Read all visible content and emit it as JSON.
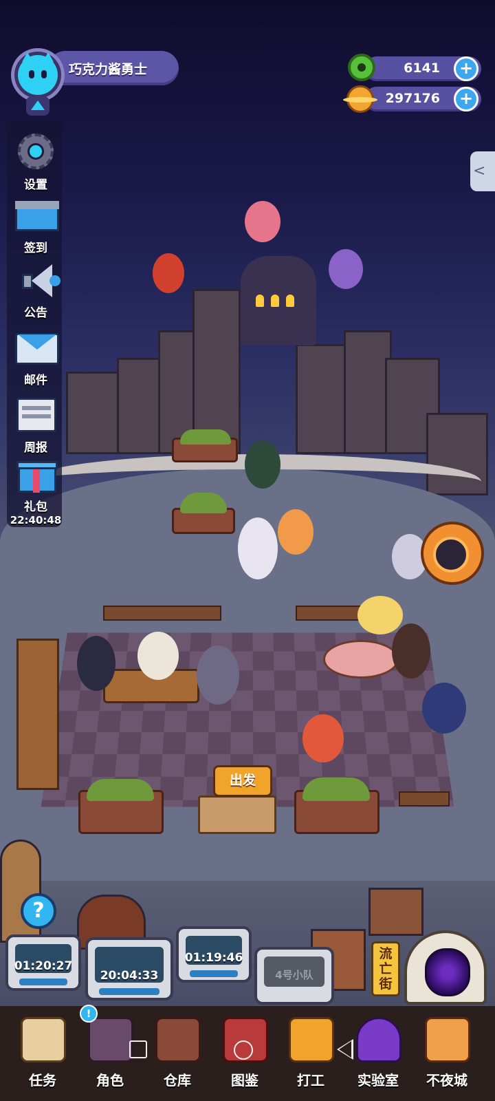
{
  "player": {
    "name": "巧克力酱勇士"
  },
  "currency": [
    {
      "name": "donut",
      "value": "6141",
      "icon": "green-donut-icon",
      "color": "#56c03a"
    },
    {
      "name": "planet-coin",
      "value": "297176",
      "icon": "orange-planet-coin-icon",
      "color": "#f3a530"
    }
  ],
  "sidebar": {
    "items": [
      {
        "label": "设置",
        "icon": "gear-icon"
      },
      {
        "label": "签到",
        "icon": "calendar-checkin-icon"
      },
      {
        "label": "公告",
        "icon": "megaphone-icon"
      },
      {
        "label": "邮件",
        "icon": "mail-envelope-icon"
      },
      {
        "label": "周报",
        "icon": "weekly-report-icon"
      },
      {
        "label": "礼包",
        "icon": "gift-box-icon",
        "timer": "22:40:48"
      }
    ]
  },
  "scene": {
    "depart_label": "出发"
  },
  "squads": [
    {
      "timer": "01:20:27"
    },
    {
      "timer": "20:04:33"
    },
    {
      "timer": "01:19:46"
    },
    {
      "label": "4号小队"
    }
  ],
  "street_sign": "流亡街",
  "nav": {
    "badge": "!",
    "items": [
      {
        "label": "任务",
        "icon": "scroll-task-icon"
      },
      {
        "label": "角色",
        "icon": "character-icon"
      },
      {
        "label": "仓库",
        "icon": "chest-warehouse-icon"
      },
      {
        "label": "图鉴",
        "icon": "book-collection-icon"
      },
      {
        "label": "打工",
        "icon": "work-frame-icon"
      },
      {
        "label": "实验室",
        "icon": "lab-capsule-icon"
      },
      {
        "label": "不夜城",
        "icon": "cat-city-icon"
      }
    ]
  },
  "colors": {
    "accent": "#2ed1f3",
    "pill": "#5d55a6",
    "sign": "#f0a42a"
  }
}
